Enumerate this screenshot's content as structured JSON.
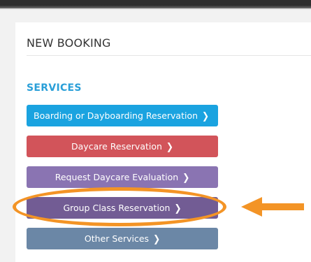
{
  "booking": {
    "title": "NEW BOOKING"
  },
  "services": {
    "title": "SERVICES",
    "buttons": [
      {
        "label": "Boarding or Dayboarding Reservation",
        "color": "#1aa3e0"
      },
      {
        "label": "Daycare Reservation",
        "color": "#d2545a"
      },
      {
        "label": "Request Daycare Evaluation",
        "color": "#8a74b2"
      },
      {
        "label": "Group Class Reservation",
        "color": "#725c94"
      },
      {
        "label": "Other Services",
        "color": "#6b87a6"
      }
    ]
  },
  "annotation": {
    "highlight_color": "#f39426",
    "highlighted_item": "Group Class Reservation"
  },
  "icons": {
    "chevron": "chevron-right-icon",
    "chevron_glyph": "❯"
  }
}
